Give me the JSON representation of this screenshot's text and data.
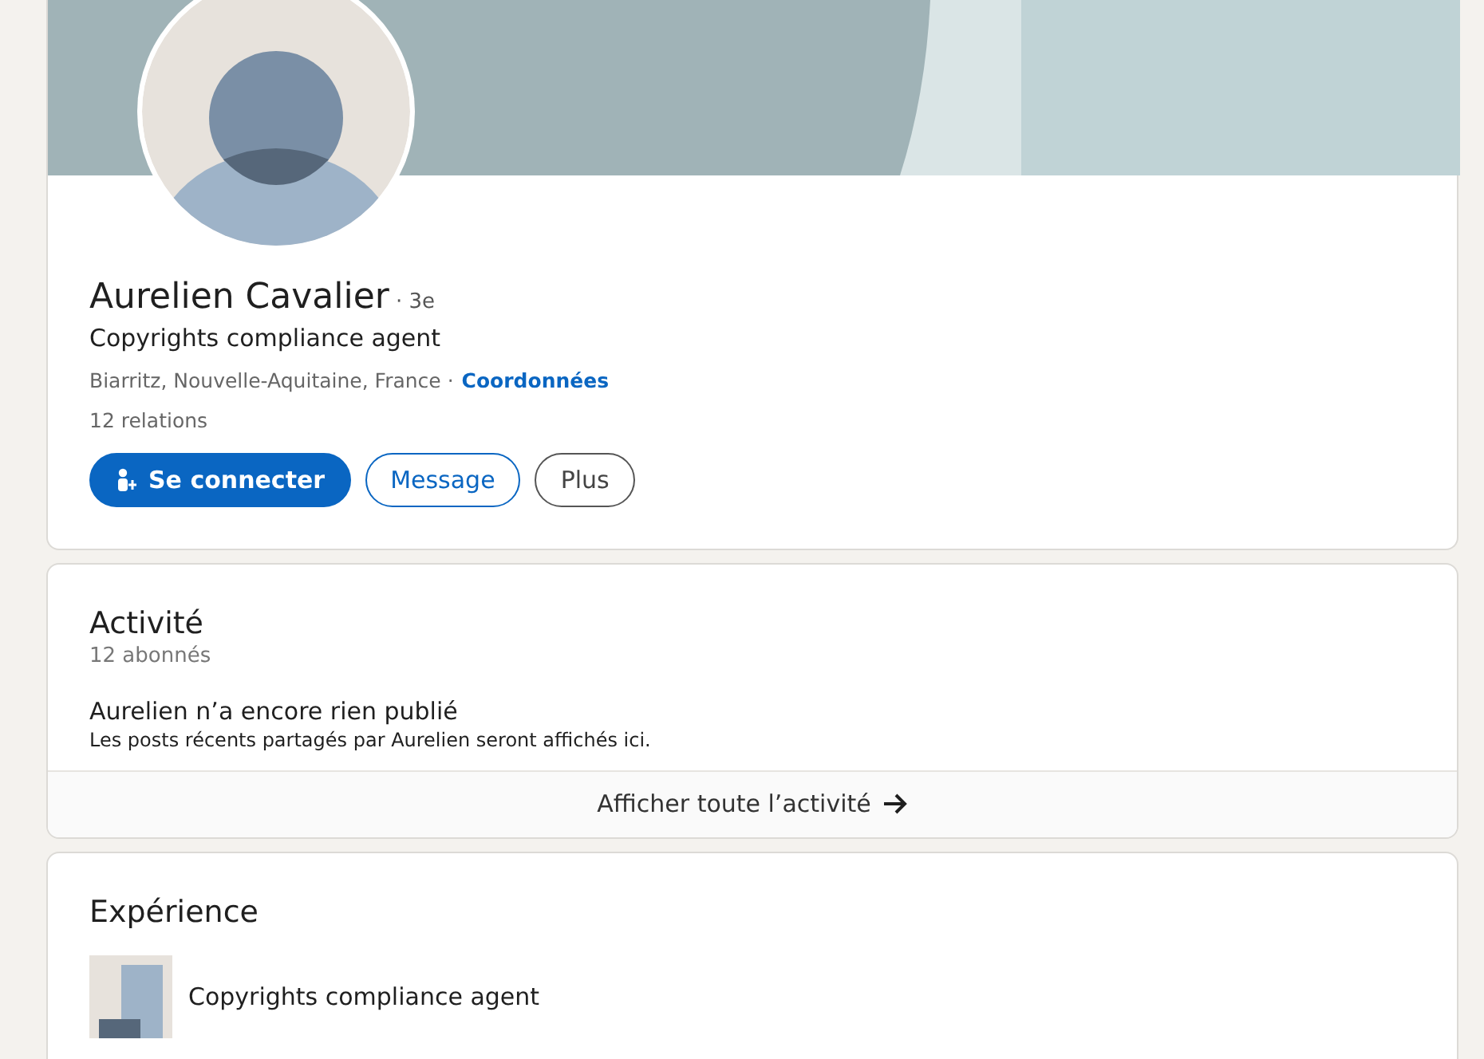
{
  "profile": {
    "name": "Aurelien Cavalier",
    "degree": "· 3e",
    "headline": "Copyrights compliance agent",
    "location": "Biarritz, Nouvelle-Aquitaine, France ·",
    "contact_link": "Coordonnées",
    "connections": "12 relations",
    "buttons": [
      {
        "label": "Se connecter",
        "kind": "primary"
      },
      {
        "label": "Message",
        "kind": "secondary"
      },
      {
        "label": "Plus",
        "kind": "outline"
      }
    ]
  },
  "activity": {
    "title": "Activité",
    "followers": "12 abonnés",
    "empty_title": "Aurelien n’a encore rien publié",
    "empty_text": "Les posts récents partagés par Aurelien seront affichés ici.",
    "show_all": "Afficher toute l’activité"
  },
  "experience": {
    "title": "Expérience",
    "items": [
      {
        "title": "Copyrights compliance agent"
      }
    ]
  }
}
